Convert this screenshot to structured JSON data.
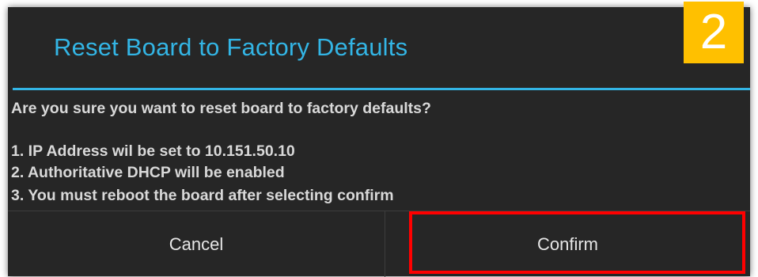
{
  "dialog": {
    "title": "Reset Board to Factory Defaults",
    "message": {
      "question": "Are you sure you want to reset board to factory defaults?",
      "lines": [
        "1. IP Address wil be set to 10.151.50.10",
        "2. Authoritative DHCP will be enabled",
        "3. You must reboot the board after selecting confirm"
      ]
    },
    "buttons": {
      "cancel_label": "Cancel",
      "confirm_label": "Confirm"
    }
  },
  "annotation": {
    "step_number": "2",
    "badge_color": "#ffc000",
    "highlight_color": "#ff0000"
  },
  "colors": {
    "accent": "#33b5e5",
    "dialog_background": "#262626",
    "text": "#d9d9d9"
  }
}
